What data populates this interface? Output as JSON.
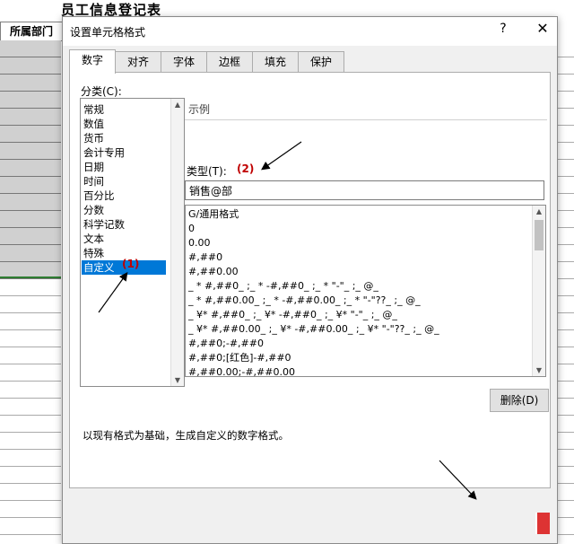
{
  "sheet": {
    "title": "员工信息登记表",
    "column_header": "所属部门"
  },
  "dialog": {
    "title": "设置单元格格式",
    "help": "?",
    "close": "✕",
    "tabs": [
      {
        "label": "数字",
        "active": true
      },
      {
        "label": "对齐",
        "active": false
      },
      {
        "label": "字体",
        "active": false
      },
      {
        "label": "边框",
        "active": false
      },
      {
        "label": "填充",
        "active": false
      },
      {
        "label": "保护",
        "active": false
      }
    ],
    "category_label": "分类(C):",
    "categories": [
      "常规",
      "数值",
      "货币",
      "会计专用",
      "日期",
      "时间",
      "百分比",
      "分数",
      "科学记数",
      "文本",
      "特殊",
      "自定义"
    ],
    "selected_category": "自定义",
    "sample_label": "示例",
    "type_label": "类型(T):",
    "type_value": "销售@部",
    "formats": [
      "G/通用格式",
      "0",
      "0.00",
      "#,##0",
      "#,##0.00",
      "_ * #,##0_ ;_ * -#,##0_ ;_ * \"-\"_ ;_ @_",
      "_ * #,##0.00_ ;_ * -#,##0.00_ ;_ * \"-\"??_ ;_ @_",
      "_ ¥* #,##0_ ;_ ¥* -#,##0_ ;_ ¥* \"-\"_ ;_ @_",
      "_ ¥* #,##0.00_ ;_ ¥* -#,##0.00_ ;_ ¥* \"-\"??_ ;_ @_",
      "#,##0;-#,##0",
      "#,##0;[红色]-#,##0",
      "#,##0.00;-#,##0.00"
    ],
    "delete_label": "删除(D)",
    "description": "以现有格式为基础，生成自定义的数字格式。"
  },
  "annotations": {
    "step1": "(1)",
    "step2": "(2)"
  },
  "colors": {
    "selection": "#0078d7",
    "annotation": "#c00000"
  }
}
